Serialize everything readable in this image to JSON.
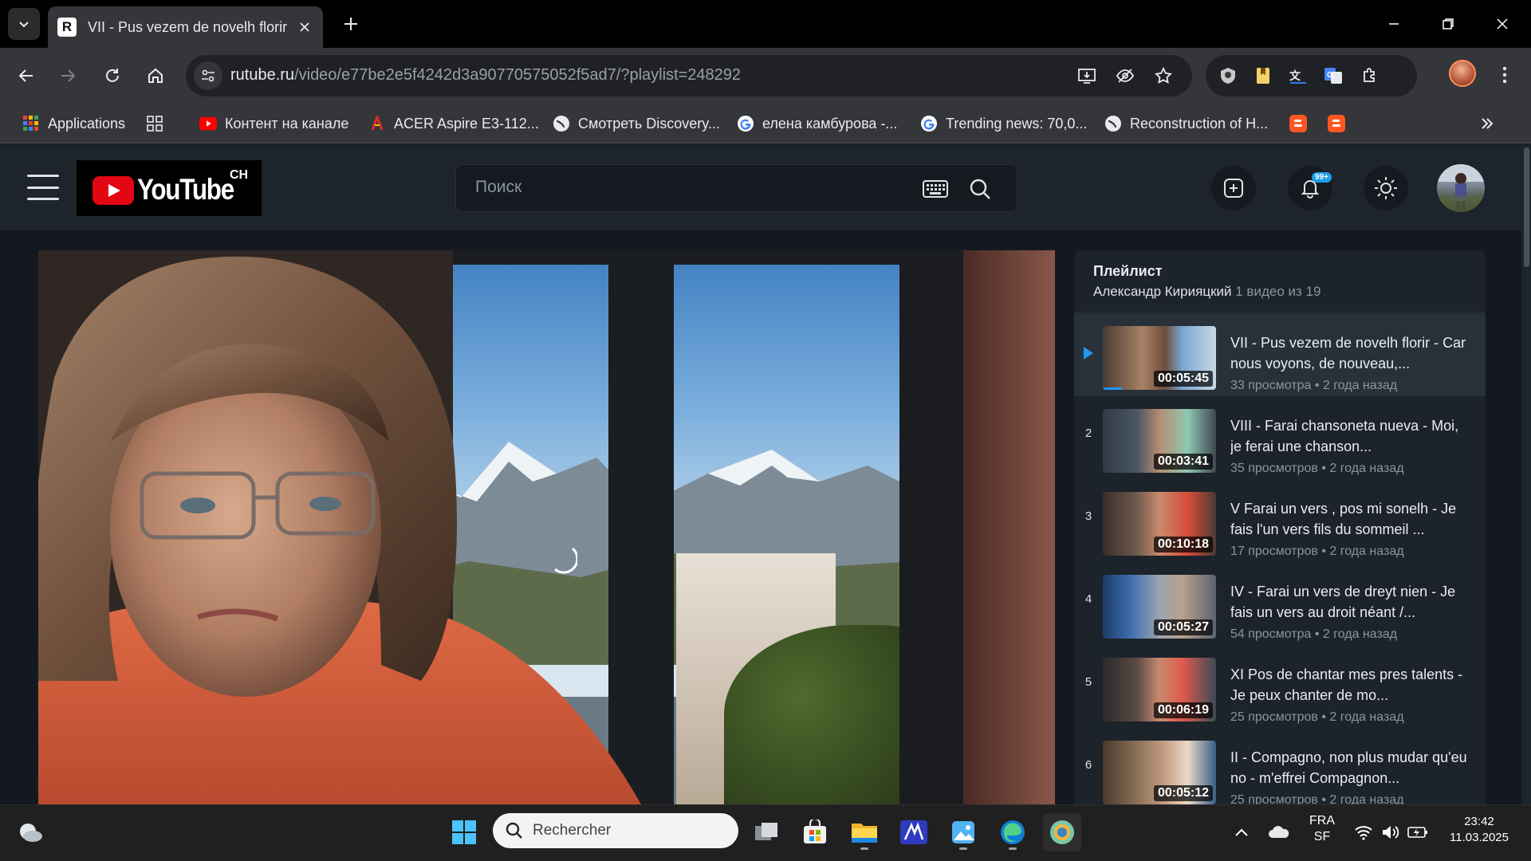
{
  "browser": {
    "tab_title": "VII - Pus vezem de novelh florir - Car nous voyons, de nouveau",
    "favicon_letter": "R",
    "url_host": "rutube.ru",
    "url_path": "/video/e77be2e5f4242d3a90770575052f5ad7/?playlist=248292"
  },
  "bookmarks": [
    {
      "label": "Applications",
      "icon": "apps-grid-icon"
    },
    {
      "label": "",
      "icon": "tab-groups-icon"
    },
    {
      "label": "Контент на канале",
      "icon": "youtube-icon"
    },
    {
      "label": "ACER Aspire E3-112...",
      "icon": "acer-icon"
    },
    {
      "label": "Смотреть Discovery...",
      "icon": "globe-icon"
    },
    {
      "label": "елена камбурова -...",
      "icon": "google-icon"
    },
    {
      "label": "Trending news: 70,0...",
      "icon": "google-icon"
    },
    {
      "label": "Reconstruction of H...",
      "icon": "globe-icon"
    }
  ],
  "site": {
    "logo_text": "YouTube",
    "logo_suffix": "CH",
    "search_placeholder": "Поиск",
    "notifications_badge": "99+"
  },
  "playlist": {
    "title": "Плейлист",
    "author": "Александр Кирияцкий",
    "position": "1 видео из 19",
    "items": [
      {
        "index": "",
        "title": "VII - Pus vezem de novelh florir - Car nous voyons, de nouveau,...",
        "duration": "00:05:45",
        "views": "33 просмотра",
        "age": "2 года назад",
        "active": true
      },
      {
        "index": "2",
        "title": "VIII - Farai chansoneta nueva - Moi, je ferai une chanson...",
        "duration": "00:03:41",
        "views": "35 просмотров",
        "age": "2 года назад",
        "active": false
      },
      {
        "index": "3",
        "title": "V Farai un vers , pos mi sonelh - Je fais l'un vers fils du sommeil ...",
        "duration": "00:10:18",
        "views": "17 просмотров",
        "age": "2 года назад",
        "active": false
      },
      {
        "index": "4",
        "title": "IV - Farai un vers de dreyt nien - Je fais un vers au droit néant /...",
        "duration": "00:05:27",
        "views": "54 просмотра",
        "age": "2 года назад",
        "active": false
      },
      {
        "index": "5",
        "title": "XI Pos de chantar mes pres talents - Je peux chanter de mo...",
        "duration": "00:06:19",
        "views": "25 просмотров",
        "age": "2 года назад",
        "active": false
      },
      {
        "index": "6",
        "title": "II - Compagno, non plus mudar qu'eu no - m'effrei Compagnon...",
        "duration": "00:05:12",
        "views": "25 просмотров",
        "age": "2 года назад",
        "active": false
      }
    ]
  },
  "taskbar": {
    "search_placeholder": "Rechercher",
    "lang": "FRA",
    "layout": "SF",
    "time": "23:42",
    "date": "11.03.2025"
  }
}
